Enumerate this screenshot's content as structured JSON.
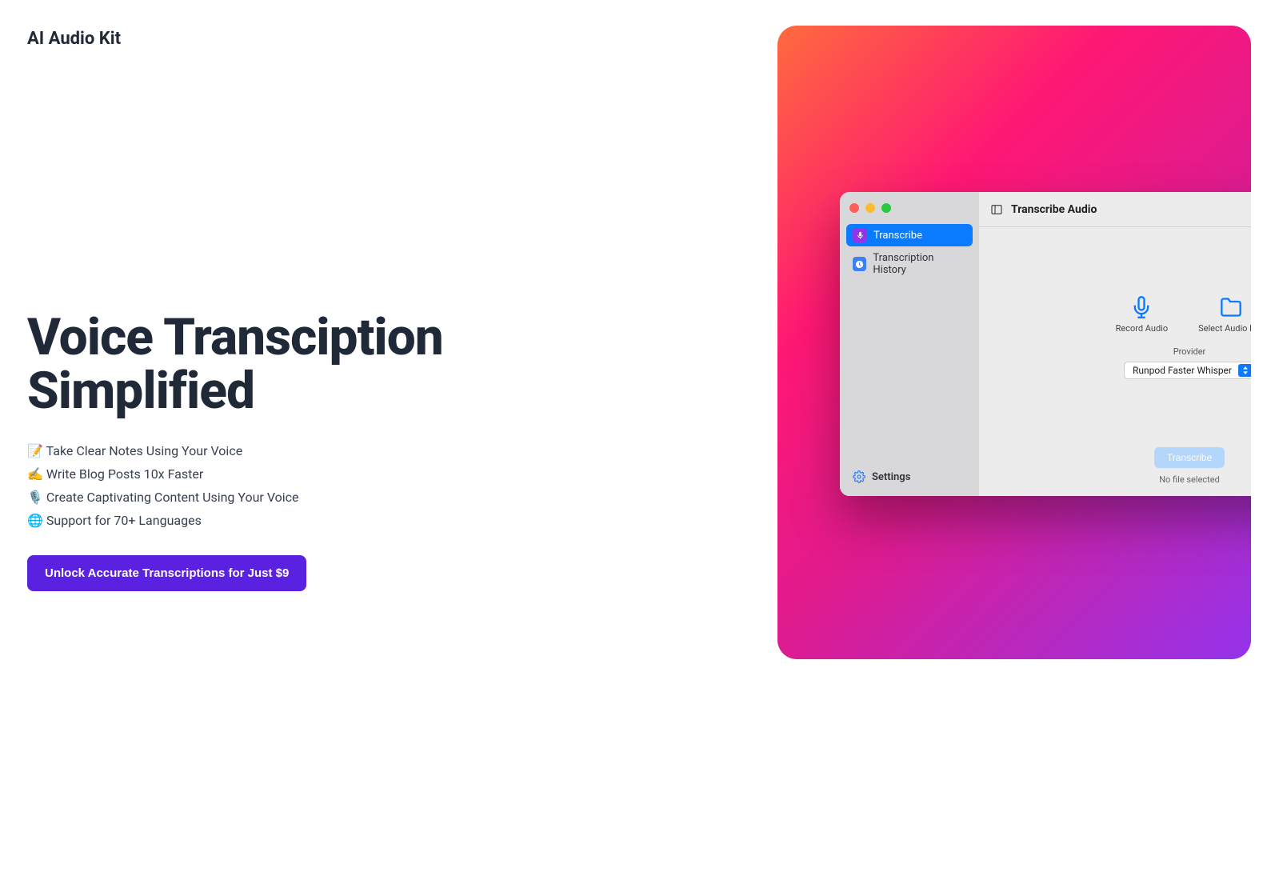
{
  "brand": "AI Audio Kit",
  "headline": "Voice Transciption Simplified",
  "features": [
    "📝 Take Clear Notes Using Your Voice",
    "✍️ Write Blog Posts 10x Faster",
    "🎙️ Create Captivating Content Using Your Voice",
    "🌐 Support for 70+ Languages"
  ],
  "cta": "Unlock Accurate Transcriptions for Just $9",
  "app": {
    "title": "Transcribe Audio",
    "sidebar": {
      "items": [
        {
          "label": "Transcribe"
        },
        {
          "label": "Transcription History"
        }
      ],
      "settings": "Settings"
    },
    "actions": {
      "record": "Record Audio",
      "select": "Select Audio File"
    },
    "provider_label": "Provider",
    "provider_value": "Runpod Faster Whisper",
    "transcribe_button": "Transcribe",
    "no_file": "No file selected"
  }
}
